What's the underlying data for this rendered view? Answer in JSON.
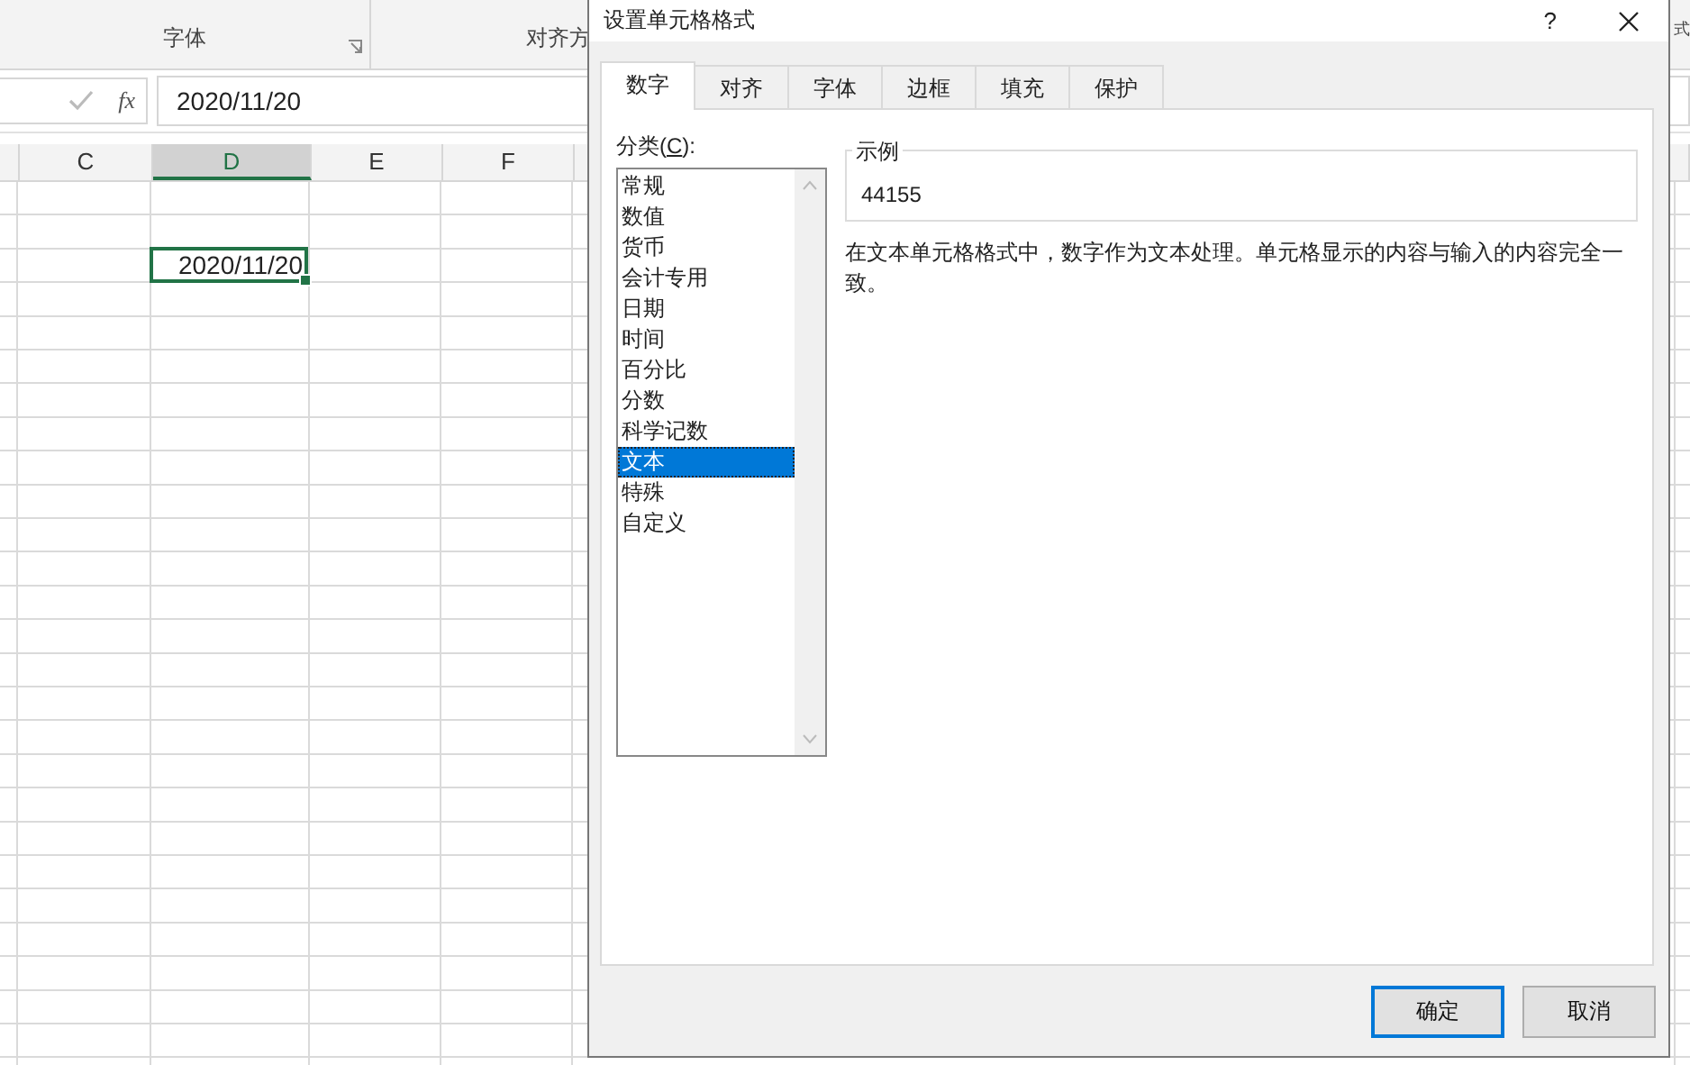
{
  "ribbon": {
    "groups": [
      {
        "label": "字体",
        "launcher": true
      },
      {
        "label": "对齐方",
        "launcher": false
      },
      {
        "label": "式",
        "launcher": false
      }
    ]
  },
  "formula_bar": {
    "function_label": "fx",
    "value": "2020/11/20"
  },
  "sheet": {
    "columns": [
      {
        "label": "C",
        "selected": false
      },
      {
        "label": "D",
        "selected": true
      },
      {
        "label": "E",
        "selected": false
      },
      {
        "label": "F",
        "selected": false
      }
    ],
    "active_cell": {
      "value": "2020/11/20"
    }
  },
  "dialog": {
    "title": "设置单元格格式",
    "help": "?",
    "tabs": [
      {
        "label": "数字",
        "selected": true
      },
      {
        "label": "对齐",
        "selected": false
      },
      {
        "label": "字体",
        "selected": false
      },
      {
        "label": "边框",
        "selected": false
      },
      {
        "label": "填充",
        "selected": false
      },
      {
        "label": "保护",
        "selected": false
      }
    ],
    "category_label": "分类(**C**):",
    "categories": [
      {
        "label": "常规",
        "selected": false
      },
      {
        "label": "数值",
        "selected": false
      },
      {
        "label": "货币",
        "selected": false
      },
      {
        "label": "会计专用",
        "selected": false
      },
      {
        "label": "日期",
        "selected": false
      },
      {
        "label": "时间",
        "selected": false
      },
      {
        "label": "百分比",
        "selected": false
      },
      {
        "label": "分数",
        "selected": false
      },
      {
        "label": "科学记数",
        "selected": false
      },
      {
        "label": "文本",
        "selected": true
      },
      {
        "label": "特殊",
        "selected": false
      },
      {
        "label": "自定义",
        "selected": false
      }
    ],
    "sample": {
      "legend": "示例",
      "value": "44155"
    },
    "description": "在文本单元格格式中，数字作为文本处理。单元格显示的内容与输入的内容完全一致。",
    "buttons": [
      {
        "label": "确定",
        "default": true
      },
      {
        "label": "取消",
        "default": false
      }
    ]
  }
}
